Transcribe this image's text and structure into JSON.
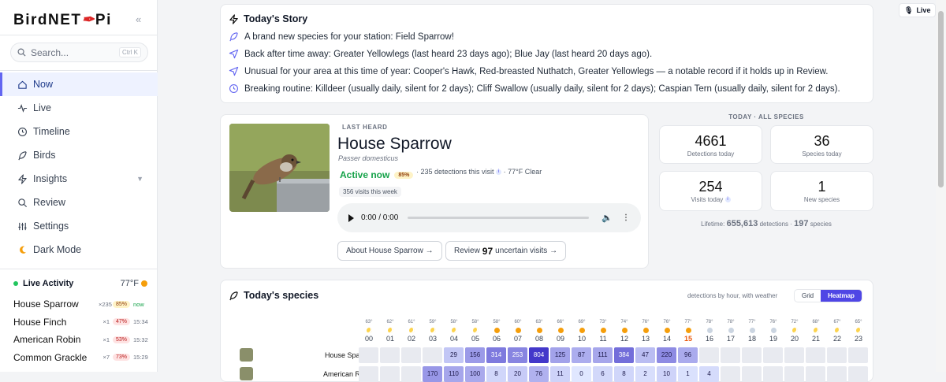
{
  "app": {
    "name_prefix": "BirdNET",
    "name_suffix": "Pi",
    "collapse": "«"
  },
  "search": {
    "placeholder": "Search...",
    "shortcut": "Ctrl K"
  },
  "nav": [
    {
      "label": "Now",
      "icon": "home-icon",
      "active": true
    },
    {
      "label": "Live",
      "icon": "pulse-icon"
    },
    {
      "label": "Timeline",
      "icon": "clock-icon"
    },
    {
      "label": "Birds",
      "icon": "feather-icon"
    },
    {
      "label": "Insights",
      "icon": "zap-icon",
      "chevron": "▼"
    },
    {
      "label": "Review",
      "icon": "search-icon"
    },
    {
      "label": "Settings",
      "icon": "sliders-icon"
    },
    {
      "label": "Dark Mode",
      "icon": "moon-icon"
    }
  ],
  "live_activity": {
    "title": "Live Activity",
    "temp": "77°F",
    "items": [
      {
        "name": "House Sparrow",
        "count": "×235",
        "pct": "85%",
        "pct_color": "#fef3c7",
        "pct_text": "#92400e",
        "time": "now"
      },
      {
        "name": "House Finch",
        "count": "×1",
        "pct": "47%",
        "pct_color": "#fee2e2",
        "pct_text": "#b91c1c",
        "time": "15:34"
      },
      {
        "name": "American Robin",
        "count": "×1",
        "pct": "53%",
        "pct_color": "#fee2e2",
        "pct_text": "#b91c1c",
        "time": "15:32"
      },
      {
        "name": "Common Grackle",
        "count": "×7",
        "pct": "73%",
        "pct_color": "#fee2e2",
        "pct_text": "#b91c1c",
        "time": "15:29"
      }
    ]
  },
  "story": {
    "title": "Today's Story",
    "lines": [
      {
        "icon": "feather-icon",
        "text": "A brand new species for your station: Field Sparrow!"
      },
      {
        "icon": "send-icon",
        "text": "Back after time away: Greater Yellowlegs (last heard 23 days ago); Blue Jay (last heard 20 days ago)."
      },
      {
        "icon": "send-icon",
        "text": "Unusual for your area at this time of year: Cooper's Hawk, Red-breasted Nuthatch, Greater Yellowlegs — a notable record if it holds up in Review."
      },
      {
        "icon": "clock-icon",
        "text": "Breaking routine: Killdeer (usually daily, silent for 2 days); Cliff Swallow (usually daily, silent for 2 days); Caspian Tern (usually daily, silent for 2 days)."
      }
    ]
  },
  "last_heard": {
    "label": "LAST HEARD",
    "name": "House Sparrow",
    "scientific": "Passer domesticus",
    "status": "Active now",
    "confidence": "85%",
    "meta_detections": "· 235 detections this visit",
    "meta_weather": "· 77°F Clear",
    "visits": "356 visits this week",
    "player_time": "0:00 / 0:00",
    "about_button": "About House Sparrow →",
    "review_prefix": "Review",
    "review_count": "97",
    "review_suffix": "uncertain visits →"
  },
  "stats": {
    "title": "TODAY · ALL SPECIES",
    "detections": {
      "value": "4661",
      "label": "Detections today"
    },
    "species": {
      "value": "36",
      "label": "Species today"
    },
    "visits": {
      "value": "254",
      "label": "Visits today"
    },
    "new_species": {
      "value": "1",
      "label": "New species"
    },
    "lifetime_label": "Lifetime:",
    "lifetime_detections": "655,613",
    "lifetime_det_label": "detections ·",
    "lifetime_species": "197",
    "lifetime_sp_label": "species"
  },
  "todays_species": {
    "title": "Today's species",
    "subtitle": "detections by hour, with weather",
    "tab_grid": "Grid",
    "tab_heatmap": "Heatmap",
    "current_hour": 15,
    "hours": [
      {
        "h": "00",
        "t": "63°",
        "w": "moon"
      },
      {
        "h": "01",
        "t": "62°",
        "w": "moon"
      },
      {
        "h": "02",
        "t": "61°",
        "w": "moon"
      },
      {
        "h": "03",
        "t": "59°",
        "w": "moon"
      },
      {
        "h": "04",
        "t": "58°",
        "w": "moon"
      },
      {
        "h": "05",
        "t": "58°",
        "w": "moon"
      },
      {
        "h": "06",
        "t": "58°",
        "w": "sun"
      },
      {
        "h": "07",
        "t": "60°",
        "w": "sun"
      },
      {
        "h": "08",
        "t": "63°",
        "w": "sun"
      },
      {
        "h": "09",
        "t": "66°",
        "w": "sun"
      },
      {
        "h": "10",
        "t": "69°",
        "w": "sun"
      },
      {
        "h": "11",
        "t": "73°",
        "w": "sun"
      },
      {
        "h": "12",
        "t": "74°",
        "w": "sun"
      },
      {
        "h": "13",
        "t": "76°",
        "w": "sun"
      },
      {
        "h": "14",
        "t": "76°",
        "w": "sun"
      },
      {
        "h": "15",
        "t": "77°",
        "w": "sun"
      },
      {
        "h": "16",
        "t": "78°",
        "w": "cloud"
      },
      {
        "h": "17",
        "t": "78°",
        "w": "cloud"
      },
      {
        "h": "18",
        "t": "77°",
        "w": "cloud"
      },
      {
        "h": "19",
        "t": "76°",
        "w": "cloud"
      },
      {
        "h": "20",
        "t": "72°",
        "w": "moon"
      },
      {
        "h": "21",
        "t": "68°",
        "w": "moon"
      },
      {
        "h": "22",
        "t": "67°",
        "w": "moon"
      },
      {
        "h": "23",
        "t": "65°",
        "w": "moon"
      }
    ],
    "rows": [
      {
        "name": "House Sparrow",
        "values": [
          null,
          null,
          null,
          null,
          29,
          156,
          314,
          253,
          804,
          125,
          87,
          111,
          384,
          47,
          220,
          96,
          null,
          null,
          null,
          null,
          null,
          null,
          null,
          null
        ]
      },
      {
        "name": "American Robin",
        "values": [
          null,
          null,
          null,
          170,
          110,
          100,
          8,
          20,
          76,
          11,
          0,
          6,
          8,
          2,
          10,
          1,
          4,
          null,
          null,
          null,
          null,
          null,
          null,
          null
        ]
      }
    ]
  },
  "live_pill": "Live"
}
